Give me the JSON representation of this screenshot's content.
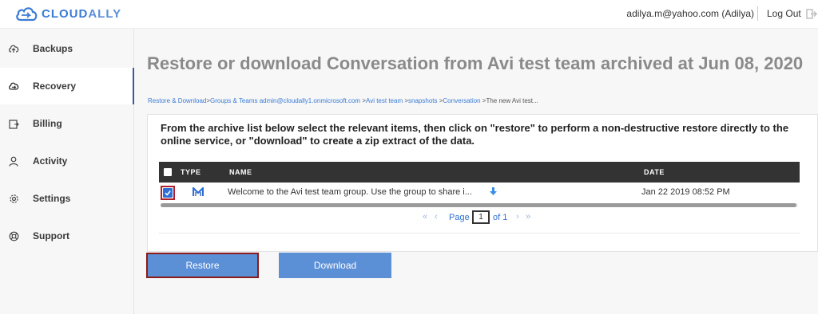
{
  "header": {
    "brand_prefix": "CLOUD",
    "brand_suffix": "ALLY",
    "user": "adilya.m@yahoo.com (Adilya)",
    "logout_label": "Log Out"
  },
  "sidebar": {
    "items": [
      {
        "label": "Backups",
        "icon": "cloud-upload-icon"
      },
      {
        "label": "Recovery",
        "icon": "cloud-restore-icon",
        "active": true
      },
      {
        "label": "Billing",
        "icon": "billing-icon"
      },
      {
        "label": "Activity",
        "icon": "user-icon"
      },
      {
        "label": "Settings",
        "icon": "gear-icon"
      },
      {
        "label": "Support",
        "icon": "lifebuoy-icon"
      }
    ]
  },
  "main": {
    "title": "Restore or download Conversation from Avi test team archived at Jun 08, 2020",
    "breadcrumb": [
      "Restore & Download",
      "Groups & Teams admin@cloudally1.onmicrosoft.com",
      "Avi test team",
      "snapshots",
      "Conversation",
      "The new Avi test..."
    ],
    "instructions": "From the archive list below select the relevant items, then click on \"restore\" to perform a non-destructive restore directly to the online service, or \"download\" to create a zip extract of the data.",
    "table": {
      "headers": {
        "type": "TYPE",
        "name": "NAME",
        "date": "DATE"
      },
      "rows": [
        {
          "type_icon": "outlook-mail-icon",
          "name": "Welcome to the Avi test team group. Use the group to share i...",
          "date": "Jan 22 2019 08:52 PM",
          "checked": true
        }
      ]
    },
    "pager": {
      "page_label": "Page",
      "current_page": "1",
      "of_label": "of 1"
    },
    "buttons": {
      "restore": "Restore",
      "download": "Download"
    }
  },
  "colors": {
    "accent": "#5b8fd6",
    "brand": "#3a7bd5",
    "highlight_border": "#8b1a1a",
    "header_dark": "#333333"
  }
}
